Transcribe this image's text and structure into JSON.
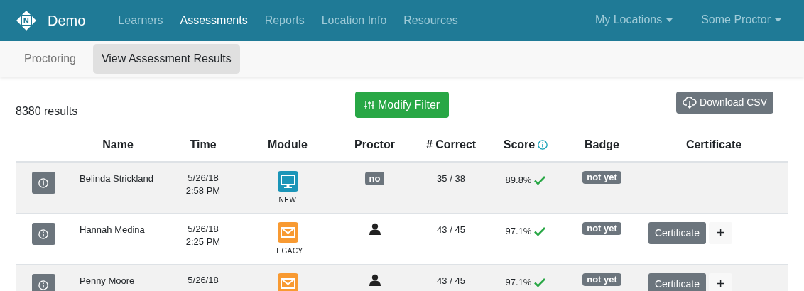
{
  "navbar": {
    "brand": "Demo",
    "links": [
      {
        "label": "Learners",
        "selected": false
      },
      {
        "label": "Assessments",
        "selected": true
      },
      {
        "label": "Reports",
        "selected": false
      },
      {
        "label": "Location Info",
        "selected": false
      },
      {
        "label": "Resources",
        "selected": false
      }
    ],
    "menus": [
      "My Locations",
      "Some Proctor"
    ]
  },
  "subnav": {
    "tabs": [
      {
        "label": "Proctoring",
        "selected": false
      },
      {
        "label": "View Assessment Results",
        "selected": true
      }
    ]
  },
  "toolbar": {
    "result_count": "8380 results",
    "filter_button": "Modify Filter",
    "download_button": "Download CSV"
  },
  "table": {
    "columns": [
      "Name",
      "Time",
      "Module",
      "Proctor",
      "# Correct",
      "Score",
      "Badge",
      "Certificate"
    ],
    "rows": [
      {
        "name": "Belinda Strickland",
        "date": "5/26/18",
        "time": "2:58 PM",
        "module": {
          "kind": "new",
          "label": "NEW"
        },
        "proctor": {
          "kind": "badge",
          "text": "no"
        },
        "correct": "35 / 38",
        "score": "89.8%",
        "passed": true,
        "badge": "not yet",
        "certificate": null
      },
      {
        "name": "Hannah Medina",
        "date": "5/26/18",
        "time": "2:25 PM",
        "module": {
          "kind": "legacy",
          "label": "LEGACY"
        },
        "proctor": {
          "kind": "person"
        },
        "correct": "43 / 45",
        "score": "97.1%",
        "passed": true,
        "badge": "not yet",
        "certificate": {
          "button": "Certificate",
          "add": "+"
        }
      },
      {
        "name": "Penny Moore",
        "date": "5/26/18",
        "module": {
          "kind": "legacy"
        },
        "proctor": {
          "kind": "person"
        },
        "correct": "43 / 45",
        "score": "97.1%",
        "passed": true,
        "badge": "not yet",
        "certificate": {
          "button": "Certificate",
          "add": "+"
        }
      }
    ]
  }
}
